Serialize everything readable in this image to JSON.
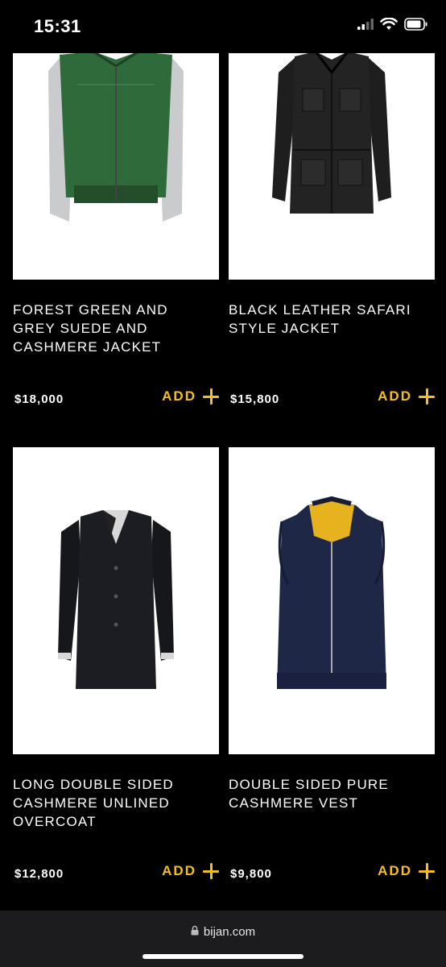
{
  "status": {
    "time": "15:31"
  },
  "browser": {
    "url": "bijan.com"
  },
  "products": [
    {
      "name": "FOREST GREEN AND GREY SUEDE AND CASHMERE JACKET",
      "price": "$18,000",
      "add_label": "ADD"
    },
    {
      "name": "BLACK LEATHER SAFARI STYLE JACKET",
      "price": "$15,800",
      "add_label": "ADD"
    },
    {
      "name": "LONG DOUBLE SIDED CASHMERE UNLINED OVERCOAT",
      "price": "$12,800",
      "add_label": "ADD"
    },
    {
      "name": "DOUBLE SIDED PURE CASHMERE VEST",
      "price": "$9,800",
      "add_label": "ADD"
    }
  ],
  "colors": {
    "accent": "#f4c020",
    "background": "#000000"
  }
}
